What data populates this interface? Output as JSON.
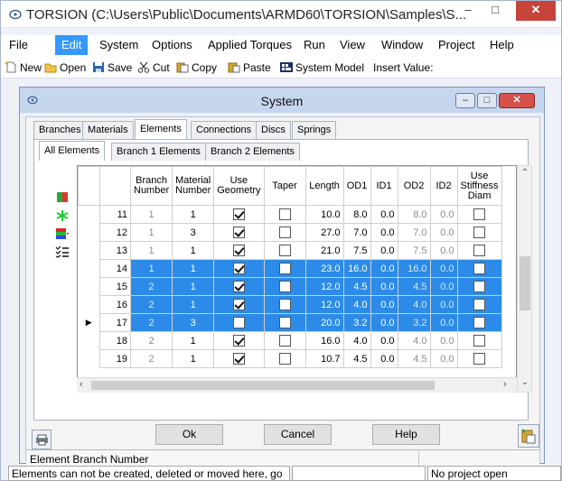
{
  "window": {
    "title": "TORSION (C:\\Users\\Public\\Documents\\ARMD60\\TORSION\\Samples\\S...",
    "min_glyph": "–",
    "max_glyph": "□",
    "close_glyph": "✕"
  },
  "menubar": {
    "items": [
      "File",
      "Edit",
      "System",
      "Options",
      "Applied Torques",
      "Run",
      "View",
      "Window",
      "Project",
      "Help"
    ]
  },
  "toolbar": {
    "new_label": "New",
    "open_label": "Open",
    "save_label": "Save",
    "cut_label": "Cut",
    "copy_label": "Copy",
    "paste_label": "Paste",
    "system_model_label": "System Model",
    "insert_value_label": "Insert Value:"
  },
  "dialog": {
    "title": "System",
    "min_glyph": "–",
    "max_glyph": "□",
    "close_glyph": "✕",
    "tabs": [
      "Branches",
      "Materials",
      "Elements",
      "Connections",
      "Discs",
      "Springs"
    ],
    "active_tab": "Elements",
    "subtabs": [
      "All Elements",
      "Branch 1 Elements",
      "Branch 2 Elements"
    ],
    "active_subtab": "All Elements",
    "grid": {
      "headers": [
        "",
        "Branch Number",
        "Material Number",
        "Use Geometry",
        "Taper",
        "Length",
        "OD1",
        "ID1",
        "OD2",
        "ID2",
        "Use Stiffness Diam"
      ],
      "rows": [
        {
          "num": "11",
          "branch": "1",
          "material": "1",
          "geom": true,
          "taper": false,
          "length": "10.0",
          "od1": "8.0",
          "id1": "0.0",
          "od2": "8.0",
          "id2": "0.0",
          "stiff": false,
          "selected": false,
          "current": false
        },
        {
          "num": "12",
          "branch": "1",
          "material": "3",
          "geom": true,
          "taper": false,
          "length": "27.0",
          "od1": "7.0",
          "id1": "0.0",
          "od2": "7.0",
          "id2": "0.0",
          "stiff": false,
          "selected": false,
          "current": false
        },
        {
          "num": "13",
          "branch": "1",
          "material": "1",
          "geom": true,
          "taper": false,
          "length": "21.0",
          "od1": "7.5",
          "id1": "0.0",
          "od2": "7.5",
          "id2": "0.0",
          "stiff": false,
          "selected": false,
          "current": false
        },
        {
          "num": "14",
          "branch": "1",
          "material": "1",
          "geom": true,
          "taper": false,
          "length": "23.0",
          "od1": "16.0",
          "id1": "0.0",
          "od2": "16.0",
          "id2": "0.0",
          "stiff": false,
          "selected": true,
          "current": false
        },
        {
          "num": "15",
          "branch": "2",
          "material": "1",
          "geom": true,
          "taper": false,
          "length": "12.0",
          "od1": "4.5",
          "id1": "0.0",
          "od2": "4.5",
          "id2": "0.0",
          "stiff": false,
          "selected": true,
          "current": false
        },
        {
          "num": "16",
          "branch": "2",
          "material": "1",
          "geom": true,
          "taper": false,
          "length": "12.0",
          "od1": "4.0",
          "id1": "0.0",
          "od2": "4.0",
          "id2": "0.0",
          "stiff": false,
          "selected": true,
          "current": false
        },
        {
          "num": "17",
          "branch": "2",
          "material": "3",
          "geom": false,
          "taper": false,
          "length": "20.0",
          "od1": "3.2",
          "id1": "0.0",
          "od2": "3.2",
          "id2": "0.0",
          "stiff": false,
          "selected": true,
          "current": true
        },
        {
          "num": "18",
          "branch": "2",
          "material": "1",
          "geom": true,
          "taper": false,
          "length": "16.0",
          "od1": "4.0",
          "id1": "0.0",
          "od2": "4.0",
          "id2": "0.0",
          "stiff": false,
          "selected": false,
          "current": false
        },
        {
          "num": "19",
          "branch": "2",
          "material": "1",
          "geom": true,
          "taper": false,
          "length": "10.7",
          "od1": "4.5",
          "id1": "0.0",
          "od2": "4.5",
          "id2": "0.0",
          "stiff": false,
          "selected": false,
          "current": false
        }
      ]
    },
    "ok_label": "Ok",
    "cancel_label": "Cancel",
    "help_label": "Help",
    "status_text": "Element Branch Number"
  },
  "statusbar": {
    "message": "Elements can not be created, deleted or moved here, go",
    "middle": "",
    "project": "No project open"
  },
  "colors": {
    "selection": "#2c8be8",
    "menu_active": "#3399ff",
    "close_red": "#c7443a"
  }
}
